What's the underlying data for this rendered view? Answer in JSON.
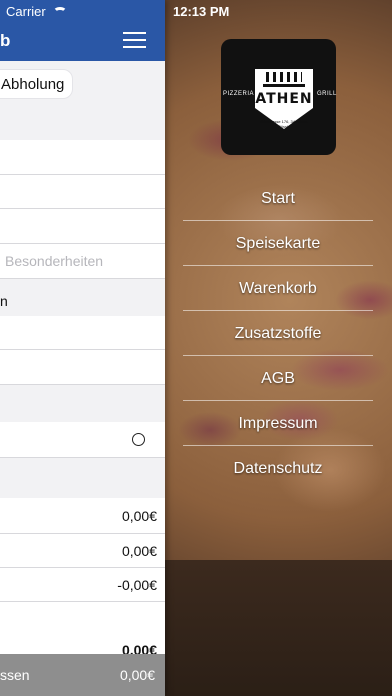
{
  "status": {
    "carrier": "Carrier",
    "time": "12:13 PM"
  },
  "nav": {
    "title": "b",
    "menu_icon": "hamburger-icon",
    "accent": "#2a57a6"
  },
  "order": {
    "pickup_label": "Abholung",
    "notes_placeholder": "Besonderheiten",
    "partial_label": "n",
    "amounts": [
      "0,00€",
      "0,00€",
      "-0,00€"
    ],
    "total_partial": "0,00€",
    "footer_label": "ssen",
    "footer_amount": "0,00€"
  },
  "logo": {
    "name": "ATHEN",
    "left_text": "PIZZERIA",
    "right_text": "GRILL",
    "address": "Südstrasse 176, 340 Beim Rössle"
  },
  "drawer": {
    "items": [
      "Start",
      "Speisekarte",
      "Warenkorb",
      "Zusatzstoffe",
      "AGB",
      "Impressum",
      "Datenschutz"
    ]
  }
}
